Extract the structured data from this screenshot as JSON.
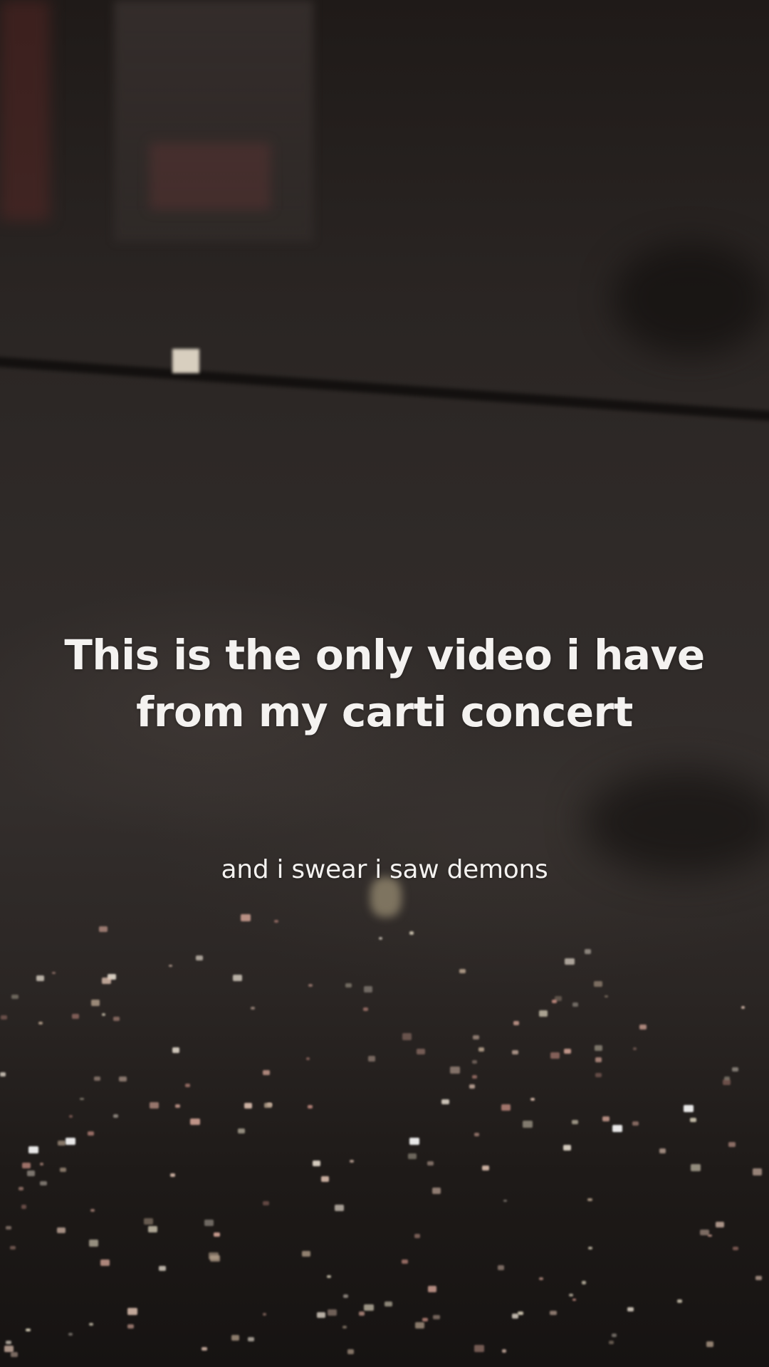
{
  "video": {
    "caption_main_line1": "This is the only video i have",
    "caption_main_line2": "from my carti concert",
    "caption_sub": "and i swear i saw demons"
  },
  "colors": {
    "caption_text": "#f4f2f0",
    "background_dark": "#1c1816",
    "haze": "#332e2c"
  }
}
